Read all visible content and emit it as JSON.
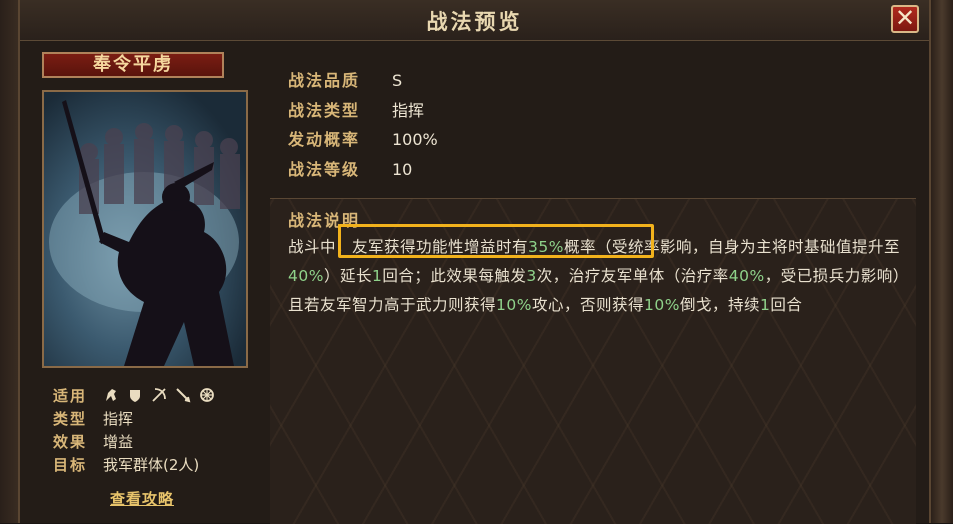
{
  "window": {
    "title": "战法预览",
    "close_label": "✕"
  },
  "skill": {
    "name": "奉令平虏",
    "attributes": {
      "suitable_label": "适用",
      "type_label": "类型",
      "type_value": "指挥",
      "effect_label": "效果",
      "effect_value": "增益",
      "target_label": "目标",
      "target_value": "我军群体(2人)",
      "suitable_icons": [
        "cavalry-icon",
        "shield-icon",
        "bow-icon",
        "spear-icon",
        "wheel-icon"
      ]
    },
    "guide_link": "查看攻略"
  },
  "info": {
    "quality_label": "战法品质",
    "quality_value": "S",
    "type_label": "战法类型",
    "type_value": "指挥",
    "rate_label": "发动概率",
    "rate_value": "100%",
    "level_label": "战法等级",
    "level_value": "10"
  },
  "description": {
    "title": "战法说明",
    "segments": [
      {
        "t": "战斗中，友军获得功能性增益时有",
        "num": false
      },
      {
        "t": "35%",
        "num": true
      },
      {
        "t": "概率（受统率影响，自身为主将时基础值提升至",
        "num": false
      },
      {
        "t": "40%",
        "num": true
      },
      {
        "t": "）延长",
        "num": false
      },
      {
        "t": "1",
        "num": true
      },
      {
        "t": "回合；此效果每触发",
        "num": false
      },
      {
        "t": "3",
        "num": true
      },
      {
        "t": "次，治疗友军单体（治疗率",
        "num": false
      },
      {
        "t": "40%",
        "num": true
      },
      {
        "t": "，受已损兵力影响）且若友军智力高于武力则获得",
        "num": false
      },
      {
        "t": "10%",
        "num": true
      },
      {
        "t": "攻心，否则获得",
        "num": false
      },
      {
        "t": "10%",
        "num": true
      },
      {
        "t": "倒戈，持续",
        "num": false
      },
      {
        "t": "1",
        "num": true
      },
      {
        "t": "回合",
        "num": false
      }
    ]
  },
  "colors": {
    "accent_gold": "#d8b678",
    "number_green": "#8fd28a",
    "highlight_box": "#f2b21c"
  }
}
